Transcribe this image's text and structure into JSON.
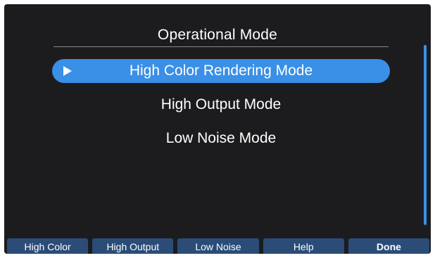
{
  "header": {
    "title": "Operational Mode"
  },
  "menu": {
    "items": [
      {
        "label": "High Color Rendering Mode",
        "selected": true
      },
      {
        "label": "High Output Mode",
        "selected": false
      },
      {
        "label": "Low Noise Mode",
        "selected": false
      }
    ]
  },
  "softkeys": {
    "high_color": "High Color",
    "high_output": "High Output",
    "low_noise": "Low Noise",
    "help": "Help",
    "done": "Done"
  },
  "colors": {
    "background": "#1c1c1e",
    "accent": "#3a8fe6",
    "softkey_bg": "#2a4c77",
    "text": "#ffffff"
  },
  "icons": {
    "selection_arrow": "play-arrow-icon"
  }
}
